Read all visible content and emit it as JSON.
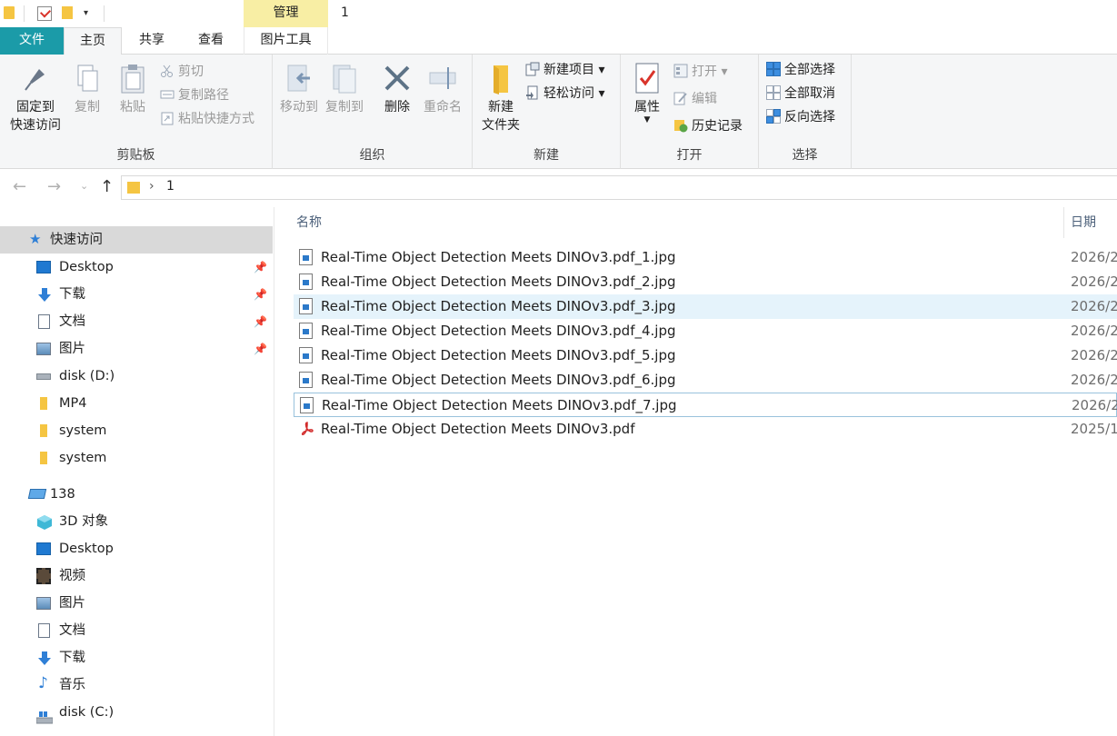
{
  "title_bar": {
    "contextual_tab": "管理",
    "window_title": "1"
  },
  "tabs": {
    "file": "文件",
    "home": "主页",
    "share": "共享",
    "view": "查看",
    "picture_tools": "图片工具"
  },
  "ribbon": {
    "clipboard": {
      "label": "剪贴板",
      "pin_line1": "固定到",
      "pin_line2": "快速访问",
      "copy": "复制",
      "paste": "粘贴",
      "cut": "剪切",
      "copy_path": "复制路径",
      "paste_shortcut": "粘贴快捷方式"
    },
    "organize": {
      "label": "组织",
      "move_to": "移动到",
      "copy_to": "复制到",
      "delete": "删除",
      "rename": "重命名"
    },
    "new": {
      "label": "新建",
      "new_folder_line1": "新建",
      "new_folder_line2": "文件夹",
      "new_item": "新建项目",
      "easy_access": "轻松访问"
    },
    "open": {
      "label": "打开",
      "properties": "属性",
      "open": "打开",
      "edit": "编辑",
      "history": "历史记录"
    },
    "select": {
      "label": "选择",
      "select_all": "全部选择",
      "select_none": "全部取消",
      "invert": "反向选择"
    }
  },
  "address": {
    "path": "1"
  },
  "nav_pane": {
    "quick_access": "快速访问",
    "quick_items": [
      {
        "label": "Desktop",
        "pinned": true
      },
      {
        "label": "下载",
        "pinned": true
      },
      {
        "label": "文档",
        "pinned": true
      },
      {
        "label": "图片",
        "pinned": true
      },
      {
        "label": "disk (D:)",
        "pinned": false
      },
      {
        "label": "MP4",
        "pinned": false
      },
      {
        "label": "system",
        "pinned": false
      },
      {
        "label": "system",
        "pinned": false
      }
    ],
    "pc": "138",
    "pc_items": [
      "3D 对象",
      "Desktop",
      "视频",
      "图片",
      "文档",
      "下载",
      "音乐",
      "disk (C:)"
    ]
  },
  "file_list": {
    "col_name": "名称",
    "col_date": "日期",
    "files": [
      {
        "name": "Real-Time Object Detection Meets DINOv3.pdf_1.jpg",
        "date": "2026/2",
        "type": "jpg"
      },
      {
        "name": "Real-Time Object Detection Meets DINOv3.pdf_2.jpg",
        "date": "2026/2",
        "type": "jpg"
      },
      {
        "name": "Real-Time Object Detection Meets DINOv3.pdf_3.jpg",
        "date": "2026/2",
        "type": "jpg"
      },
      {
        "name": "Real-Time Object Detection Meets DINOv3.pdf_4.jpg",
        "date": "2026/2",
        "type": "jpg"
      },
      {
        "name": "Real-Time Object Detection Meets DINOv3.pdf_5.jpg",
        "date": "2026/2",
        "type": "jpg"
      },
      {
        "name": "Real-Time Object Detection Meets DINOv3.pdf_6.jpg",
        "date": "2026/2",
        "type": "jpg"
      },
      {
        "name": "Real-Time Object Detection Meets DINOv3.pdf_7.jpg",
        "date": "2026/2",
        "type": "jpg"
      },
      {
        "name": "Real-Time Object Detection Meets DINOv3.pdf",
        "date": "2025/1",
        "type": "pdf"
      }
    ]
  },
  "colors": {
    "file_tab": "#1b9ba8",
    "manage_tab": "#f8eea4",
    "selection": "#e5f3fb",
    "folder": "#f5c542"
  }
}
